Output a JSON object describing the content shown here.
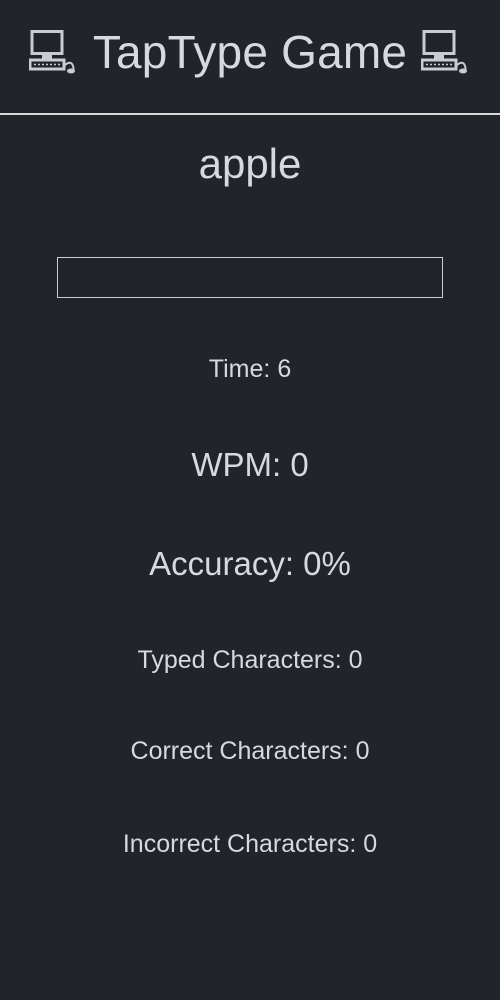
{
  "header": {
    "title": "TapType Game",
    "left_icon": "desktop-computer-icon",
    "right_icon": "desktop-computer-icon"
  },
  "game": {
    "current_word": "apple",
    "input_value": "",
    "input_placeholder": ""
  },
  "stats": {
    "time_label": "Time: ",
    "time_value": "6",
    "wpm_label": "WPM: ",
    "wpm_value": "0",
    "accuracy_label": "Accuracy: ",
    "accuracy_value": "0%",
    "typed_label": "Typed Characters: ",
    "typed_value": "0",
    "correct_label": "Correct Characters: ",
    "correct_value": "0",
    "incorrect_label": "Incorrect Characters: ",
    "incorrect_value": "0"
  },
  "colors": {
    "background": "#212428",
    "text": "#d6d9de",
    "divider": "#d8d8d8"
  }
}
